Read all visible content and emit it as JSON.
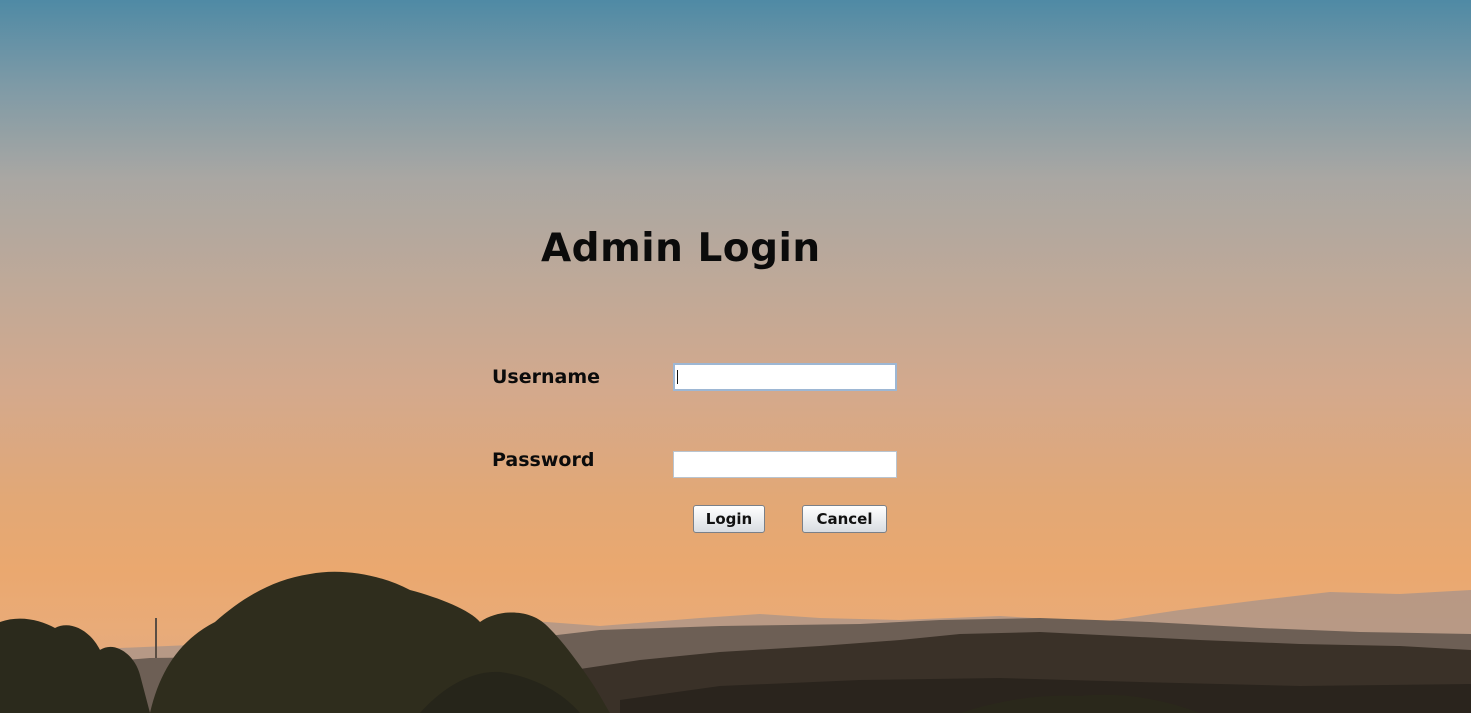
{
  "login_form": {
    "title": "Admin Login",
    "username_label": "Username",
    "username_value": "",
    "password_label": "Password",
    "password_value": "",
    "login_button": "Login",
    "cancel_button": "Cancel"
  },
  "colors": {
    "sky_top": "#4f8aa5",
    "sky_bottom": "#eaa86f",
    "text": "#0b0b0b"
  }
}
